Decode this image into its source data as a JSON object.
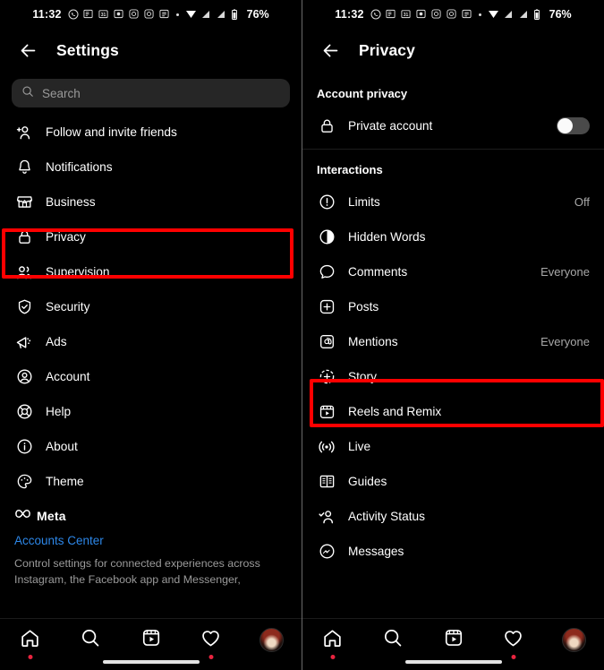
{
  "status_bar": {
    "time": "11:32",
    "battery": "76%",
    "icons": [
      "whatsapp-icon",
      "news-icon",
      "calendar-icon",
      "app-icon",
      "instagram-icon",
      "instagram-icon-2",
      "app-icon-2",
      "dot-icon",
      "wifi-icon",
      "signal-icon-1",
      "signal-icon-2",
      "battery-icon"
    ]
  },
  "left_panel": {
    "title": "Settings",
    "back_icon": "back-arrow-icon",
    "search": {
      "placeholder": "Search",
      "icon": "search-icon"
    },
    "items": [
      {
        "label": "Follow and invite friends",
        "icon": "add-person-icon"
      },
      {
        "label": "Notifications",
        "icon": "bell-icon"
      },
      {
        "label": "Business",
        "icon": "storefront-icon"
      },
      {
        "label": "Privacy",
        "icon": "lock-icon",
        "highlighted": true
      },
      {
        "label": "Supervision",
        "icon": "people-icon"
      },
      {
        "label": "Security",
        "icon": "shield-check-icon"
      },
      {
        "label": "Ads",
        "icon": "megaphone-icon"
      },
      {
        "label": "Account",
        "icon": "account-circle-icon"
      },
      {
        "label": "Help",
        "icon": "lifebuoy-icon"
      },
      {
        "label": "About",
        "icon": "info-circle-icon"
      },
      {
        "label": "Theme",
        "icon": "palette-icon"
      }
    ],
    "meta_brand": {
      "name": "Meta",
      "icon": "meta-infinity-icon"
    },
    "accounts_center_link": "Accounts Center",
    "meta_description": "Control settings for connected experiences across Instagram, the Facebook app and Messenger, including story and post sharing and logging in."
  },
  "right_panel": {
    "title": "Privacy",
    "back_icon": "back-arrow-icon",
    "sections": [
      {
        "header": "Account privacy",
        "items": [
          {
            "label": "Private account",
            "icon": "lock-icon",
            "control": "toggle",
            "toggle_on": false
          }
        ]
      },
      {
        "header": "Interactions",
        "items": [
          {
            "label": "Limits",
            "icon": "exclamation-circle-icon",
            "value": "Off"
          },
          {
            "label": "Hidden Words",
            "icon": "eye-hidden-icon",
            "value": ""
          },
          {
            "label": "Comments",
            "icon": "comment-bubble-icon",
            "value": "Everyone"
          },
          {
            "label": "Posts",
            "icon": "plus-square-icon",
            "value": ""
          },
          {
            "label": "Mentions",
            "icon": "at-sign-icon",
            "value": "Everyone"
          },
          {
            "label": "Story",
            "icon": "story-plus-icon",
            "value": "",
            "highlighted": true
          },
          {
            "label": "Reels and Remix",
            "icon": "reels-icon",
            "value": ""
          },
          {
            "label": "Live",
            "icon": "live-broadcast-icon",
            "value": ""
          },
          {
            "label": "Guides",
            "icon": "guides-book-icon",
            "value": ""
          },
          {
            "label": "Activity Status",
            "icon": "activity-status-icon",
            "value": ""
          },
          {
            "label": "Messages",
            "icon": "messenger-icon",
            "value": ""
          }
        ]
      }
    ]
  },
  "bottom_nav": {
    "items": [
      {
        "name": "home",
        "icon": "home-icon",
        "badge": true
      },
      {
        "name": "search",
        "icon": "search-icon",
        "badge": false
      },
      {
        "name": "reels",
        "icon": "reels-icon",
        "badge": false
      },
      {
        "name": "activity",
        "icon": "heart-icon",
        "badge": true
      },
      {
        "name": "profile",
        "icon": "avatar-icon",
        "badge": false
      }
    ]
  },
  "colors": {
    "background": "#000000",
    "highlight": "#ff0000",
    "link": "#2d87e8",
    "muted_text": "#9a9a9a",
    "search_bg": "#262626",
    "badge": "#e8243f"
  }
}
